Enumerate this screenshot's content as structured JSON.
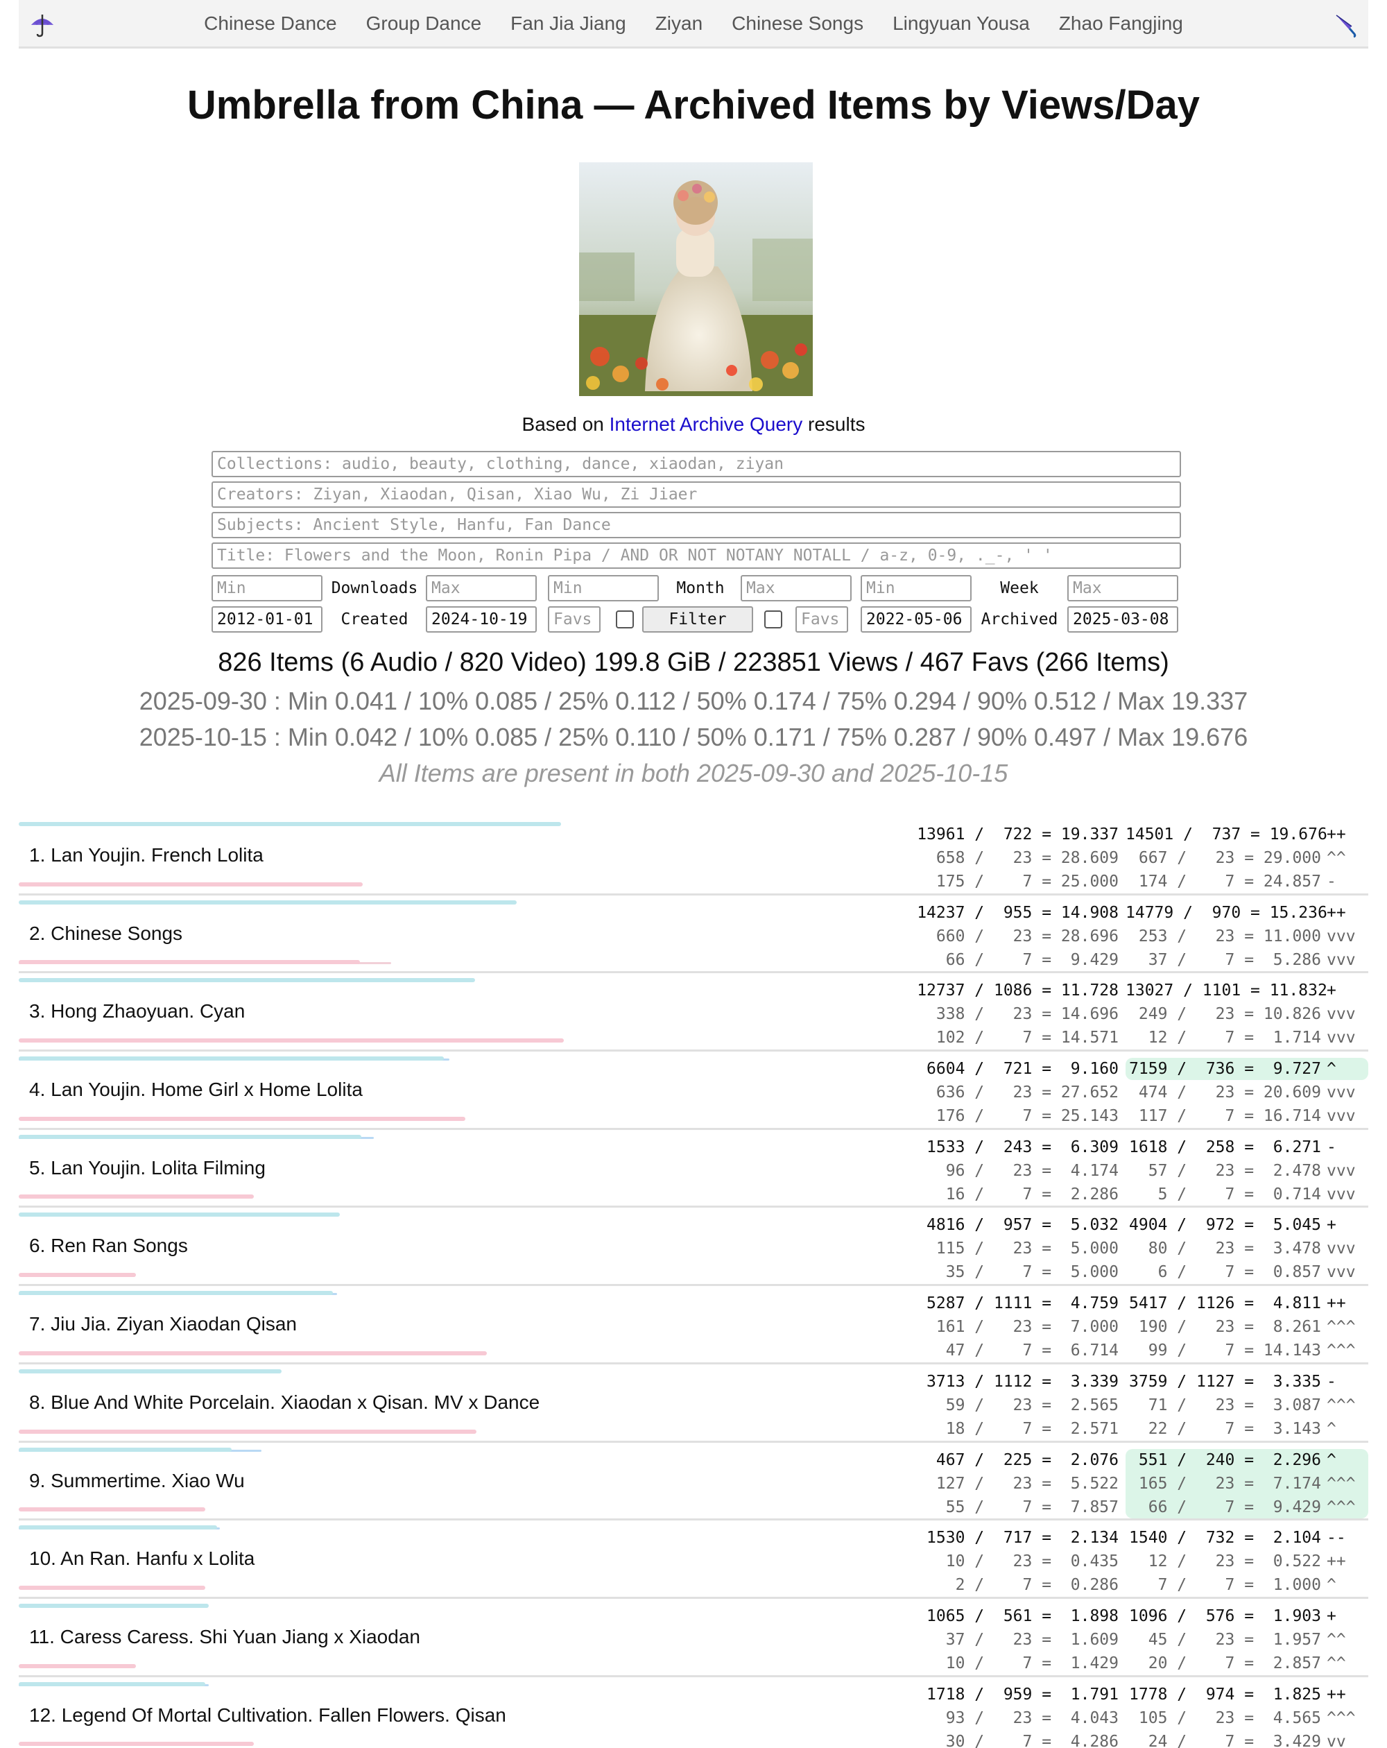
{
  "nav": {
    "links": [
      "Chinese Dance",
      "Group Dance",
      "Fan Jia Jiang",
      "Ziyan",
      "Chinese Songs",
      "Lingyuan Yousa",
      "Zhao Fangjing"
    ],
    "left_icon": "umbrella-icon",
    "right_icon": "closed-umbrella-icon"
  },
  "page": {
    "title": "Umbrella from China — Archived Items by Views/Day",
    "based_prefix": "Based on",
    "based_link": "Internet Archive Query",
    "based_suffix": "results"
  },
  "filters": {
    "collections_placeholder": "Collections: audio, beauty, clothing, dance, xiaodan, ziyan",
    "creators_placeholder": "Creators: Ziyan, Xiaodan, Qisan, Xiao Wu, Zi Jiaer",
    "subjects_placeholder": "Subjects: Ancient Style, Hanfu, Fan Dance",
    "title_placeholder": "Title: Flowers and the Moon, Ronin Pipa / AND OR NOT NOTANY NOTALL / a-z, 0-9, ._-, ' '",
    "min_placeholder": "Min",
    "max_placeholder": "Max",
    "favs_placeholder": "Favs",
    "downloads_label": "Downloads",
    "month_label": "Month",
    "week_label": "Week",
    "created_label": "Created",
    "archived_label": "Archived",
    "created_from": "2012-01-01",
    "created_to": "2024-10-19",
    "archived_from": "2022-05-06",
    "archived_to": "2025-03-08",
    "filter_button": "Filter"
  },
  "summary": {
    "line": "826 Items (6 Audio / 820 Video) 199.8 GiB / 223851 Views / 467 Favs (266 Items)",
    "stat1": "2025-09-30 : Min 0.041 / 10% 0.085 / 25% 0.112 / 50% 0.174 / 75% 0.294 / 90% 0.512 / Max 19.337",
    "stat2": "2025-10-15 : Min 0.042 / 10% 0.085 / 25% 0.110 / 50% 0.171 / 75% 0.287 / 90% 0.497 / Max 19.676",
    "note": "All Items are present in both 2025-09-30 and 2025-10-15"
  },
  "items": [
    {
      "name": "1. Lan Youjin. French Lolita",
      "top": 0.402,
      "top2": 0.0,
      "bot": 0.255,
      "bot2": 0.0,
      "hl": [],
      "lines": [
        [
          "13961 /  722 = 19.337",
          "14501 /  737 = 19.676",
          "++"
        ],
        [
          "658 /   23 = 28.609",
          "667 /   23 = 29.000",
          "^^"
        ],
        [
          "175 /    7 = 25.000",
          "174 /    7 = 24.857",
          "-"
        ]
      ]
    },
    {
      "name": "2. Chinese Songs",
      "top": 0.369,
      "top2": 0.0,
      "bot": 0.253,
      "bot2": 0.276,
      "hl": [],
      "lines": [
        [
          "14237 /  955 = 14.908",
          "14779 /  970 = 15.236",
          "++"
        ],
        [
          "660 /   23 = 28.696",
          "253 /   23 = 11.000",
          "vvv"
        ],
        [
          "66 /    7 =  9.429",
          "37 /    7 =  5.286",
          "vvv"
        ]
      ]
    },
    {
      "name": "3. Hong Zhaoyuan. Cyan",
      "top": 0.338,
      "top2": 0.0,
      "bot": 0.404,
      "bot2": 0.0,
      "hl": [],
      "lines": [
        [
          "12737 / 1086 = 11.728",
          "13027 / 1101 = 11.832",
          "+"
        ],
        [
          "338 /   23 = 14.696",
          "249 /   23 = 10.826",
          "vvv"
        ],
        [
          "102 /    7 = 14.571",
          "12 /    7 =  1.714",
          "vvv"
        ]
      ]
    },
    {
      "name": "4. Lan Youjin. Home Girl x Home Lolita",
      "top": 0.315,
      "top2": 0.319,
      "bot": 0.331,
      "bot2": 0.0,
      "hl": [
        0
      ],
      "lines": [
        [
          "6604 /  721 =  9.160",
          "7159 /  736 =  9.727",
          "^"
        ],
        [
          "636 /   23 = 27.652",
          "474 /   23 = 20.609",
          "vvv"
        ],
        [
          "176 /    7 = 25.143",
          "117 /    7 = 16.714",
          "vvv"
        ]
      ]
    },
    {
      "name": "5. Lan Youjin. Lolita Filming",
      "top": 0.254,
      "top2": 0.263,
      "bot": 0.174,
      "bot2": 0.0,
      "hl": [],
      "lines": [
        [
          "1533 /  243 =  6.309",
          "1618 /  258 =  6.271",
          "-"
        ],
        [
          "96 /   23 =  4.174",
          "57 /   23 =  2.478",
          "vvv"
        ],
        [
          "16 /    7 =  2.286",
          "5 /    7 =  0.714",
          "vvv"
        ]
      ]
    },
    {
      "name": "6. Ren Ran Songs",
      "top": 0.238,
      "top2": 0.0,
      "bot": 0.087,
      "bot2": 0.0,
      "hl": [],
      "lines": [
        [
          "4816 /  957 =  5.032",
          "4904 /  972 =  5.045",
          "+"
        ],
        [
          "115 /   23 =  5.000",
          "80 /   23 =  3.478",
          "vvv"
        ],
        [
          "35 /    7 =  5.000",
          "6 /    7 =  0.857",
          "vvv"
        ]
      ]
    },
    {
      "name": "7. Jiu Jia. Ziyan Xiaodan Qisan",
      "top": 0.233,
      "top2": 0.236,
      "bot": 0.347,
      "bot2": 0.0,
      "hl": [],
      "lines": [
        [
          "5287 / 1111 =  4.759",
          "5417 / 1126 =  4.811",
          "++"
        ],
        [
          "161 /   23 =  7.000",
          "190 /   23 =  8.261",
          "^^^"
        ],
        [
          "47 /    7 =  6.714",
          "99 /    7 = 14.143",
          "^^^"
        ]
      ]
    },
    {
      "name": "8. Blue And White Porcelain. Xiaodan x Qisan. MV x Dance",
      "top": 0.195,
      "top2": 0.0,
      "bot": 0.339,
      "bot2": 0.0,
      "hl": [],
      "lines": [
        [
          "3713 / 1112 =  3.339",
          "3759 / 1127 =  3.335",
          "-"
        ],
        [
          "59 /   23 =  2.565",
          "71 /   23 =  3.087",
          "^^^"
        ],
        [
          "18 /    7 =  2.571",
          "22 /    7 =  3.143",
          "^"
        ]
      ]
    },
    {
      "name": "9. Summertime. Xiao Wu",
      "top": 0.158,
      "top2": 0.18,
      "bot": 0.138,
      "bot2": 0.0,
      "hl": [
        0,
        1,
        2
      ],
      "lines": [
        [
          "467 /  225 =  2.076",
          "551 /  240 =  2.296",
          "^"
        ],
        [
          "127 /   23 =  5.522",
          "165 /   23 =  7.174",
          "^^^"
        ],
        [
          "55 /    7 =  7.857",
          "66 /    7 =  9.429",
          "^^^"
        ]
      ]
    },
    {
      "name": "10. An Ran. Hanfu x Lolita",
      "top": 0.147,
      "top2": 0.149,
      "bot": 0.138,
      "bot2": 0.0,
      "hl": [],
      "lines": [
        [
          "1530 /  717 =  2.134",
          "1540 /  732 =  2.104",
          "--"
        ],
        [
          "10 /   23 =  0.435",
          "12 /   23 =  0.522",
          "++"
        ],
        [
          "2 /    7 =  0.286",
          "7 /    7 =  1.000",
          "^"
        ]
      ]
    },
    {
      "name": "11. Caress Caress. Shi Yuan Jiang x Xiaodan",
      "top": 0.141,
      "top2": 0.0,
      "bot": 0.087,
      "bot2": 0.0,
      "hl": [],
      "lines": [
        [
          "1065 /  561 =  1.898",
          "1096 /  576 =  1.903",
          "+"
        ],
        [
          "37 /   23 =  1.609",
          "45 /   23 =  1.957",
          "^^"
        ],
        [
          "10 /    7 =  1.429",
          "20 /    7 =  2.857",
          "^^"
        ]
      ]
    },
    {
      "name": "12. Legend Of Mortal Cultivation. Fallen Flowers. Qisan",
      "top": 0.138,
      "top2": 0.141,
      "bot": 0.174,
      "bot2": 0.0,
      "hl": [],
      "lines": [
        [
          "1718 /  959 =  1.791",
          "1778 /  974 =  1.825",
          "++"
        ],
        [
          "93 /   23 =  4.043",
          "105 /   23 =  4.565",
          "^^^"
        ],
        [
          "30 /    7 =  4.286",
          "24 /    7 =  3.429",
          "vv"
        ]
      ]
    }
  ]
}
